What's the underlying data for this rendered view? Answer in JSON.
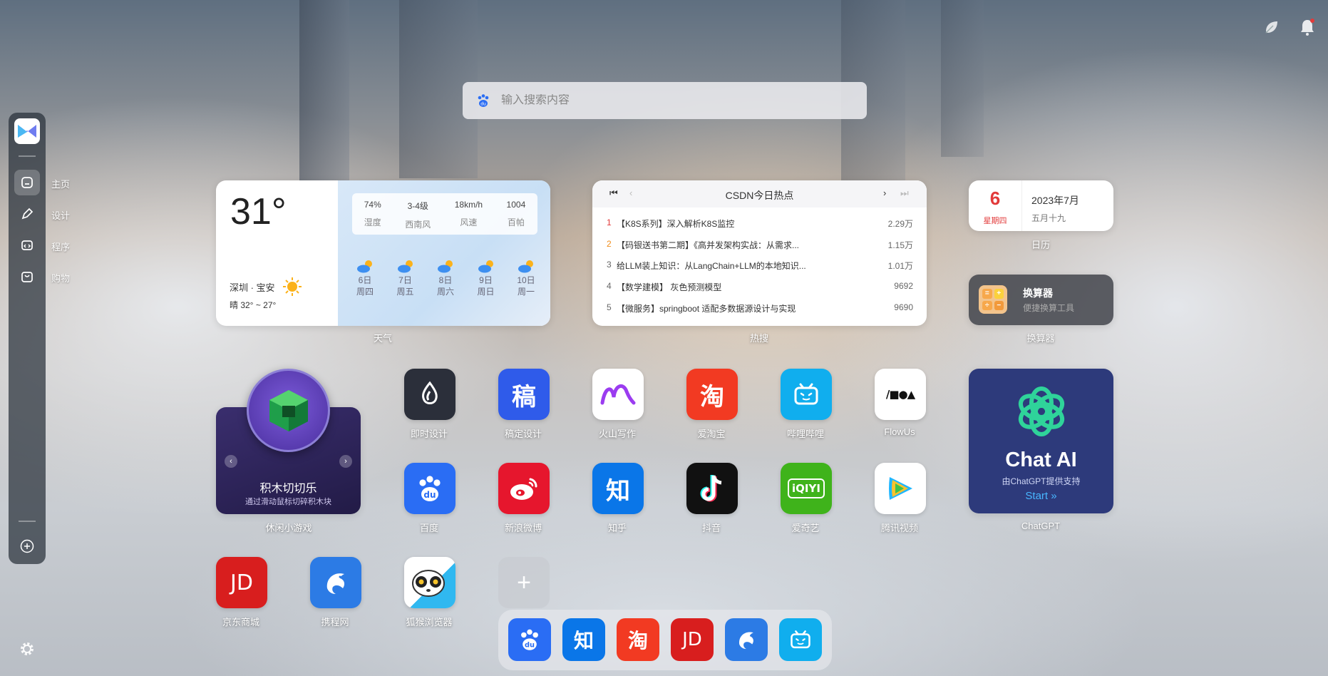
{
  "search": {
    "placeholder": "输入搜索内容"
  },
  "sidebar": {
    "items": [
      {
        "label": "主页",
        "icon": "home-icon"
      },
      {
        "label": "设计",
        "icon": "pen-icon"
      },
      {
        "label": "程序",
        "icon": "code-icon"
      },
      {
        "label": "购物",
        "icon": "shopping-bag-icon"
      }
    ]
  },
  "weather": {
    "temp": "31°",
    "location": "深圳 · 宝安",
    "range": "晴 32° ~ 27°",
    "stats": [
      {
        "value": "74%",
        "label": "湿度"
      },
      {
        "value": "3-4级",
        "label": "西南风"
      },
      {
        "value": "18km/h",
        "label": "风速"
      },
      {
        "value": "1004",
        "label": "百帕"
      }
    ],
    "days": [
      {
        "date": "6日",
        "week": "周四"
      },
      {
        "date": "7日",
        "week": "周五"
      },
      {
        "date": "8日",
        "week": "周六"
      },
      {
        "date": "9日",
        "week": "周日"
      },
      {
        "date": "10日",
        "week": "周一"
      }
    ],
    "caption": "天气"
  },
  "hot": {
    "title": "CSDN今日热点",
    "caption": "热搜",
    "rows": [
      {
        "rank": "1",
        "title": "【K8S系列】深入解析K8S监控",
        "count": "2.29万"
      },
      {
        "rank": "2",
        "title": "【码银送书第二期】《高并发架构实战：从需求...",
        "count": "1.15万"
      },
      {
        "rank": "3",
        "title": "给LLM装上知识：从LangChain+LLM的本地知识...",
        "count": "1.01万"
      },
      {
        "rank": "4",
        "title": "【数学建模】 灰色预测模型",
        "count": "9692"
      },
      {
        "rank": "5",
        "title": "【微服务】springboot 适配多数据源设计与实现",
        "count": "9690"
      }
    ],
    "colors": {
      "rank1": "#e23a3a",
      "rank2": "#f08c1a",
      "rest": "#666666"
    }
  },
  "calendar": {
    "day": "6",
    "weekday": "星期四",
    "year_month": "2023年7月",
    "lunar": "五月十九",
    "caption": "日历"
  },
  "calculator": {
    "title": "换算器",
    "subtitle": "便捷换算工具",
    "caption": "换算器"
  },
  "game": {
    "title": "积木切切乐",
    "subtitle": "通过滑动鼠标切碎积木块",
    "caption": "休闲小游戏"
  },
  "apps": {
    "row1": [
      {
        "label": "即时设计",
        "color": "#2b2f3a",
        "glyph": ""
      },
      {
        "label": "稿定设计",
        "color": "#2f5bea",
        "glyph": "稿"
      },
      {
        "label": "火山写作",
        "color": "#ffffff",
        "glyph": ""
      },
      {
        "label": "爱淘宝",
        "color": "#f23a22",
        "glyph": "淘"
      },
      {
        "label": "哔哩哔哩",
        "color": "#10aeee",
        "glyph": ""
      },
      {
        "label": "FlowUs",
        "color": "#ffffff",
        "glyph": "/■●▲"
      }
    ],
    "row2": [
      {
        "label": "百度",
        "color": "#2a6df4",
        "glyph": "du"
      },
      {
        "label": "新浪微博",
        "color": "#e6162d",
        "glyph": ""
      },
      {
        "label": "知乎",
        "color": "#0a76e8",
        "glyph": "知"
      },
      {
        "label": "抖音",
        "color": "#111111",
        "glyph": "♪"
      },
      {
        "label": "爱奇艺",
        "color": "#3fb31b",
        "glyph": "iQIYI"
      },
      {
        "label": "腾讯视频",
        "color": "#ffffff",
        "glyph": "▶"
      }
    ],
    "row3": [
      {
        "label": "京东商城",
        "color": "#d81e1e",
        "glyph": "JD"
      },
      {
        "label": "携程网",
        "color": "#2c7be5",
        "glyph": ""
      },
      {
        "label": "狐猴浏览器",
        "color": "#ffffff",
        "glyph": ""
      }
    ]
  },
  "chatgpt": {
    "title": "Chat AI",
    "subtitle": "由ChatGPT提供支持",
    "start": "Start »",
    "caption": "ChatGPT"
  },
  "dock": [
    {
      "name": "百度",
      "color": "#2a6df4",
      "glyph": "du"
    },
    {
      "name": "知乎",
      "color": "#0a76e8",
      "glyph": "知"
    },
    {
      "name": "淘宝",
      "color": "#f23a22",
      "glyph": "淘"
    },
    {
      "name": "京东",
      "color": "#d81e1e",
      "glyph": "JD"
    },
    {
      "name": "携程",
      "color": "#2c7be5",
      "glyph": ""
    },
    {
      "name": "哔哩哔哩",
      "color": "#10aeee",
      "glyph": ""
    }
  ],
  "add_tile": {
    "glyph": "+"
  }
}
